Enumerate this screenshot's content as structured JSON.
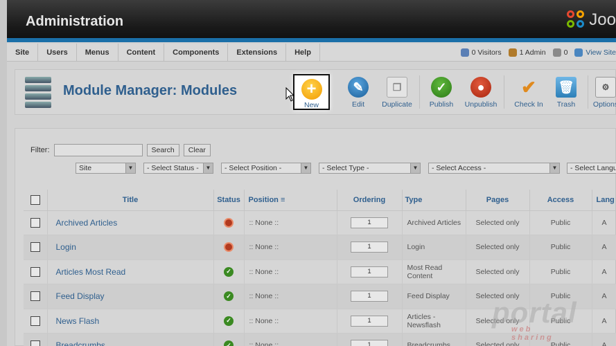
{
  "header": {
    "title": "Administration",
    "logo_text": "Joo"
  },
  "menu": [
    "Site",
    "Users",
    "Menus",
    "Content",
    "Components",
    "Extensions",
    "Help"
  ],
  "status": {
    "visitors": "0 Visitors",
    "admins": "1 Admin",
    "messages": "0",
    "view_site": "View Site"
  },
  "page": {
    "title": "Module Manager: Modules"
  },
  "toolbar": {
    "new": "New",
    "edit": "Edit",
    "duplicate": "Duplicate",
    "publish": "Publish",
    "unpublish": "Unpublish",
    "checkin": "Check In",
    "trash": "Trash",
    "options": "Options"
  },
  "filter": {
    "label": "Filter:",
    "search": "Search",
    "clear": "Clear"
  },
  "selects": [
    "Site",
    "- Select Status -",
    "- Select Position -",
    "- Select Type -",
    "- Select Access -",
    "- Select Language -"
  ],
  "columns": [
    "Title",
    "Status",
    "Position",
    "Ordering",
    "Type",
    "Pages",
    "Access",
    "Lang"
  ],
  "rows": [
    {
      "title": "Archived Articles",
      "status": "unpublished",
      "position": ":: None ::",
      "ordering": "1",
      "type": "Archived Articles",
      "pages": "Selected only",
      "access": "Public",
      "lang": "A"
    },
    {
      "title": "Login",
      "status": "unpublished",
      "position": ":: None ::",
      "ordering": "1",
      "type": "Login",
      "pages": "Selected only",
      "access": "Public",
      "lang": "A"
    },
    {
      "title": "Articles Most Read",
      "status": "published",
      "position": ":: None ::",
      "ordering": "1",
      "type": "Most Read Content",
      "pages": "Selected only",
      "access": "Public",
      "lang": "A"
    },
    {
      "title": "Feed Display",
      "status": "published",
      "position": ":: None ::",
      "ordering": "1",
      "type": "Feed Display",
      "pages": "Selected only",
      "access": "Public",
      "lang": "A"
    },
    {
      "title": "News Flash",
      "status": "published",
      "position": ":: None ::",
      "ordering": "1",
      "type": "Articles - Newsflash",
      "pages": "Selected only",
      "access": "Public",
      "lang": "A"
    },
    {
      "title": "Breadcrumbs",
      "status": "published",
      "position": ":: None ::",
      "ordering": "1",
      "type": "Breadcrumbs",
      "pages": "Selected only",
      "access": "Public",
      "lang": "A"
    }
  ],
  "watermark": {
    "main": "portal",
    "sub": "web sharing"
  },
  "colors": {
    "accent": "#2f5f8e",
    "header": "#1a1a1a",
    "bluebar": "#1a6fa8",
    "new_icon": "#f29b00"
  }
}
